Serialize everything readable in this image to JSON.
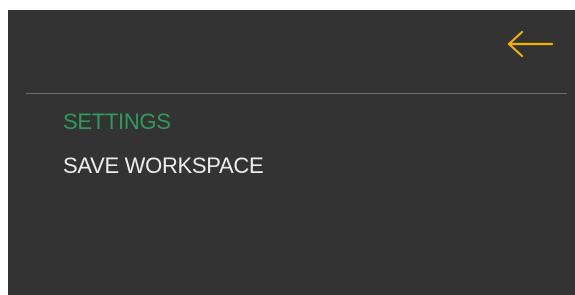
{
  "header": {
    "back_icon": "arrow-left-icon",
    "back_icon_color": "#f0b400"
  },
  "menu": {
    "items": [
      {
        "label": "SETTINGS",
        "color": "#2e9a5e",
        "active": true
      },
      {
        "label": "SAVE WORKSPACE",
        "color": "#ececec",
        "active": false
      }
    ]
  },
  "colors": {
    "panel_background": "#333333",
    "divider": "#6e6e6e"
  }
}
